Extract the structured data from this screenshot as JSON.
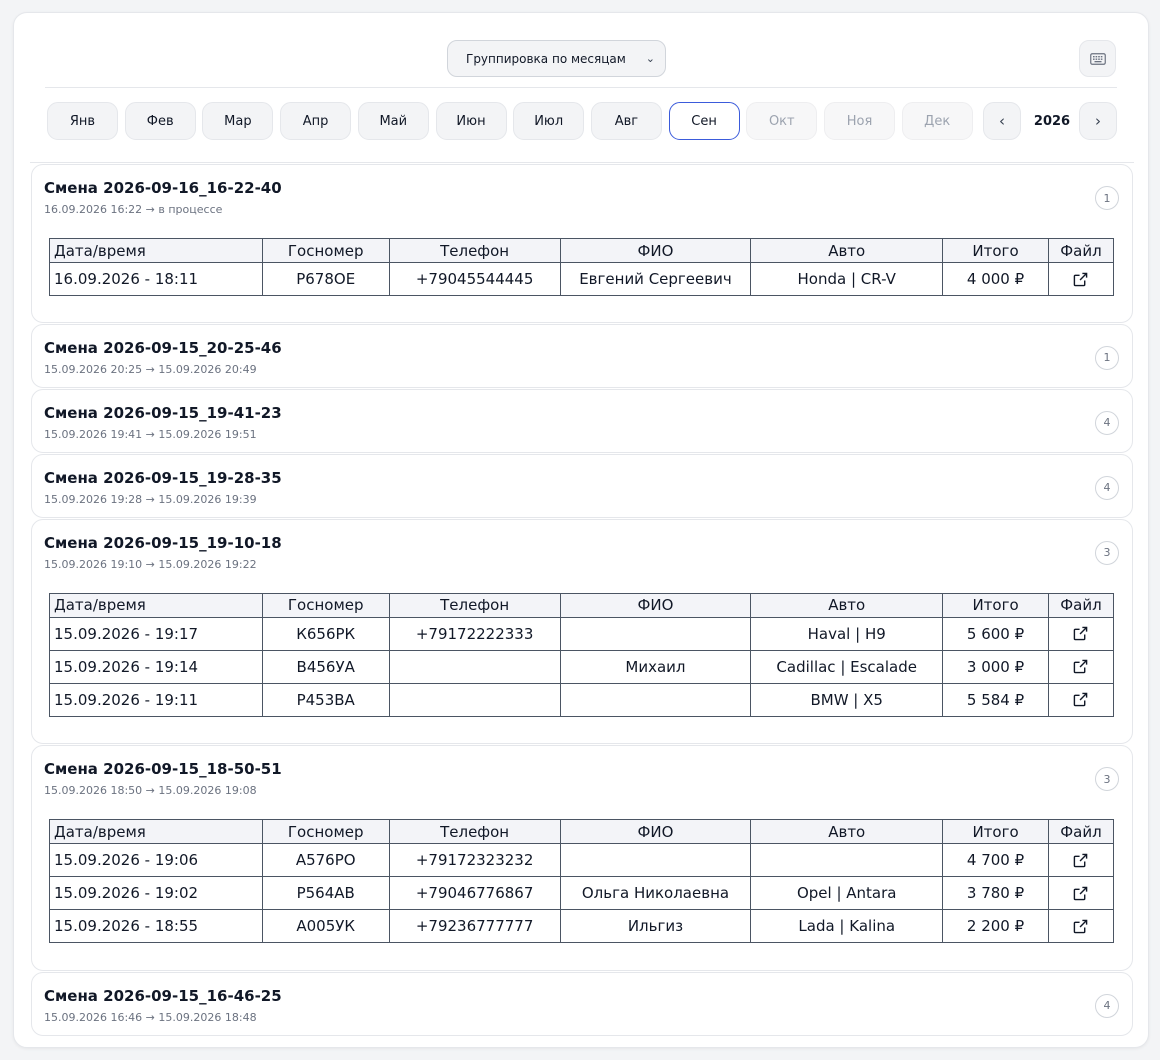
{
  "toolbar": {
    "grouping_value": "Группировка по месяцам",
    "keyboard_icon": "keyboard-icon"
  },
  "months": [
    {
      "label": "Янв",
      "state": "normal"
    },
    {
      "label": "Фев",
      "state": "normal"
    },
    {
      "label": "Мар",
      "state": "normal"
    },
    {
      "label": "Апр",
      "state": "normal"
    },
    {
      "label": "Май",
      "state": "normal"
    },
    {
      "label": "Июн",
      "state": "normal"
    },
    {
      "label": "Июл",
      "state": "normal"
    },
    {
      "label": "Авг",
      "state": "normal"
    },
    {
      "label": "Сен",
      "state": "active"
    },
    {
      "label": "Окт",
      "state": "disabled"
    },
    {
      "label": "Ноя",
      "state": "disabled"
    },
    {
      "label": "Дек",
      "state": "disabled"
    }
  ],
  "year_nav": {
    "prev": "‹",
    "year": "2026",
    "next": "›"
  },
  "table_headers": [
    "Дата/время",
    "Госномер",
    "Телефон",
    "ФИО",
    "Авто",
    "Итого",
    "Файл"
  ],
  "shifts": [
    {
      "title": "Смена 2026-09-16_16-22-40",
      "subtitle": "16.09.2026 16:22 → в процессе",
      "count": "1",
      "expanded": true,
      "rows": [
        [
          "16.09.2026 - 18:11",
          "Р678ОЕ",
          "+79045544445",
          "Евгений Сергеевич",
          "Honda | CR-V",
          "4 000 ₽"
        ]
      ]
    },
    {
      "title": "Смена 2026-09-15_20-25-46",
      "subtitle": "15.09.2026 20:25 → 15.09.2026 20:49",
      "count": "1",
      "expanded": false,
      "rows": []
    },
    {
      "title": "Смена 2026-09-15_19-41-23",
      "subtitle": "15.09.2026 19:41 → 15.09.2026 19:51",
      "count": "4",
      "expanded": false,
      "rows": []
    },
    {
      "title": "Смена 2026-09-15_19-28-35",
      "subtitle": "15.09.2026 19:28 → 15.09.2026 19:39",
      "count": "4",
      "expanded": false,
      "rows": []
    },
    {
      "title": "Смена 2026-09-15_19-10-18",
      "subtitle": "15.09.2026 19:10 → 15.09.2026 19:22",
      "count": "3",
      "expanded": true,
      "rows": [
        [
          "15.09.2026 - 19:17",
          "К656РК",
          "+79172222333",
          "",
          "Haval | H9",
          "5 600 ₽"
        ],
        [
          "15.09.2026 - 19:14",
          "В456УА",
          "",
          "Михаил",
          "Cadillac | Escalade",
          "3 000 ₽"
        ],
        [
          "15.09.2026 - 19:11",
          "Р453ВА",
          "",
          "",
          "BMW | X5",
          "5 584 ₽"
        ]
      ]
    },
    {
      "title": "Смена 2026-09-15_18-50-51",
      "subtitle": "15.09.2026 18:50 → 15.09.2026 19:08",
      "count": "3",
      "expanded": true,
      "rows": [
        [
          "15.09.2026 - 19:06",
          "А576РО",
          "+79172323232",
          "",
          "",
          "4 700 ₽"
        ],
        [
          "15.09.2026 - 19:02",
          "Р564АВ",
          "+79046776867",
          "Ольга Николаевна",
          "Opel | Antara",
          "3 780 ₽"
        ],
        [
          "15.09.2026 - 18:55",
          "А005УК",
          "+79236777777",
          "Ильгиз",
          "Lada | Kalina",
          "2 200 ₽"
        ]
      ]
    },
    {
      "title": "Смена 2026-09-15_16-46-25",
      "subtitle": "15.09.2026 16:46 → 15.09.2026 18:48",
      "count": "4",
      "expanded": false,
      "rows": []
    }
  ],
  "file_icon": "external-link-icon",
  "colors": {
    "accent": "#3b5bdb",
    "border": "#4b5563",
    "header_bg": "#f3f4f8"
  }
}
